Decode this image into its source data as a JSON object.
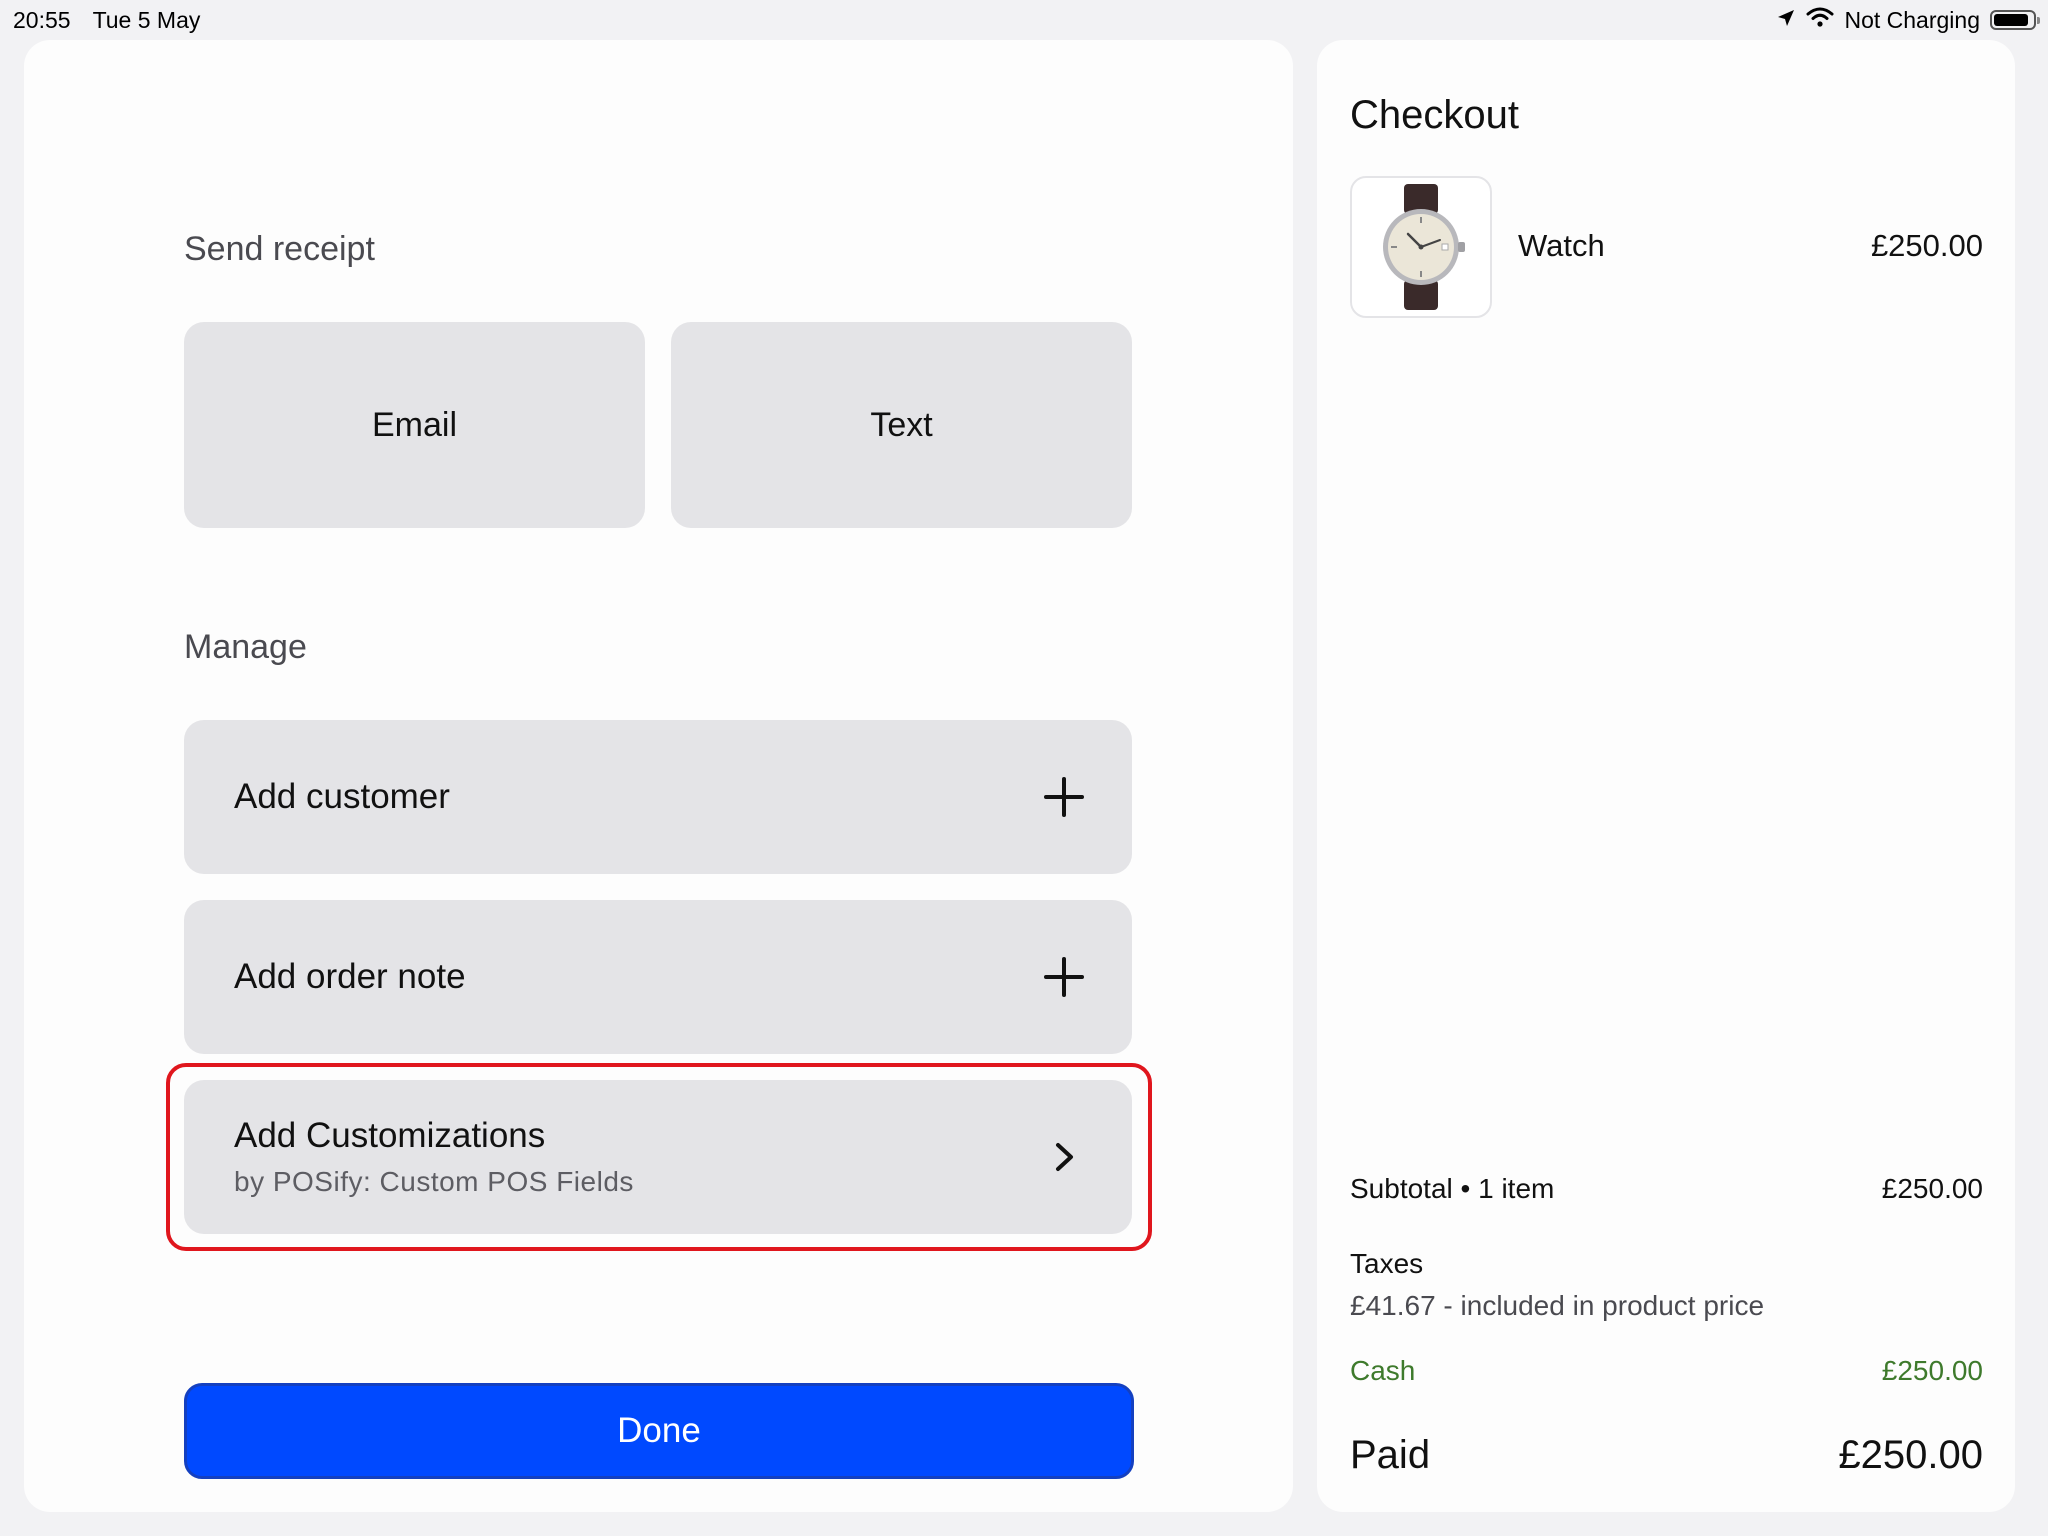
{
  "status_bar": {
    "time": "20:55",
    "date": "Tue 5 May",
    "charging_status": "Not Charging",
    "battery_level": 0.9
  },
  "receipt": {
    "heading": "Send receipt",
    "email_label": "Email",
    "text_label": "Text"
  },
  "manage": {
    "heading": "Manage",
    "add_customer_label": "Add customer",
    "add_order_note_label": "Add order note",
    "add_customizations_label": "Add Customizations",
    "add_customizations_sub": "by POSify: Custom POS Fields"
  },
  "done_label": "Done",
  "checkout": {
    "title": "Checkout",
    "item": {
      "name": "Watch",
      "price": "£250.00"
    },
    "subtotal_label": "Subtotal • 1 item",
    "subtotal_value": "£250.00",
    "taxes_label": "Taxes",
    "taxes_detail": "£41.67 - included in product price",
    "cash_label": "Cash",
    "cash_value": "£250.00",
    "paid_label": "Paid",
    "paid_value": "£250.00"
  },
  "colors": {
    "primary_button": "#0049ff",
    "highlight": "#e0161d",
    "cash_green": "#3e7a2c",
    "tile_background": "#e4e4e7"
  }
}
